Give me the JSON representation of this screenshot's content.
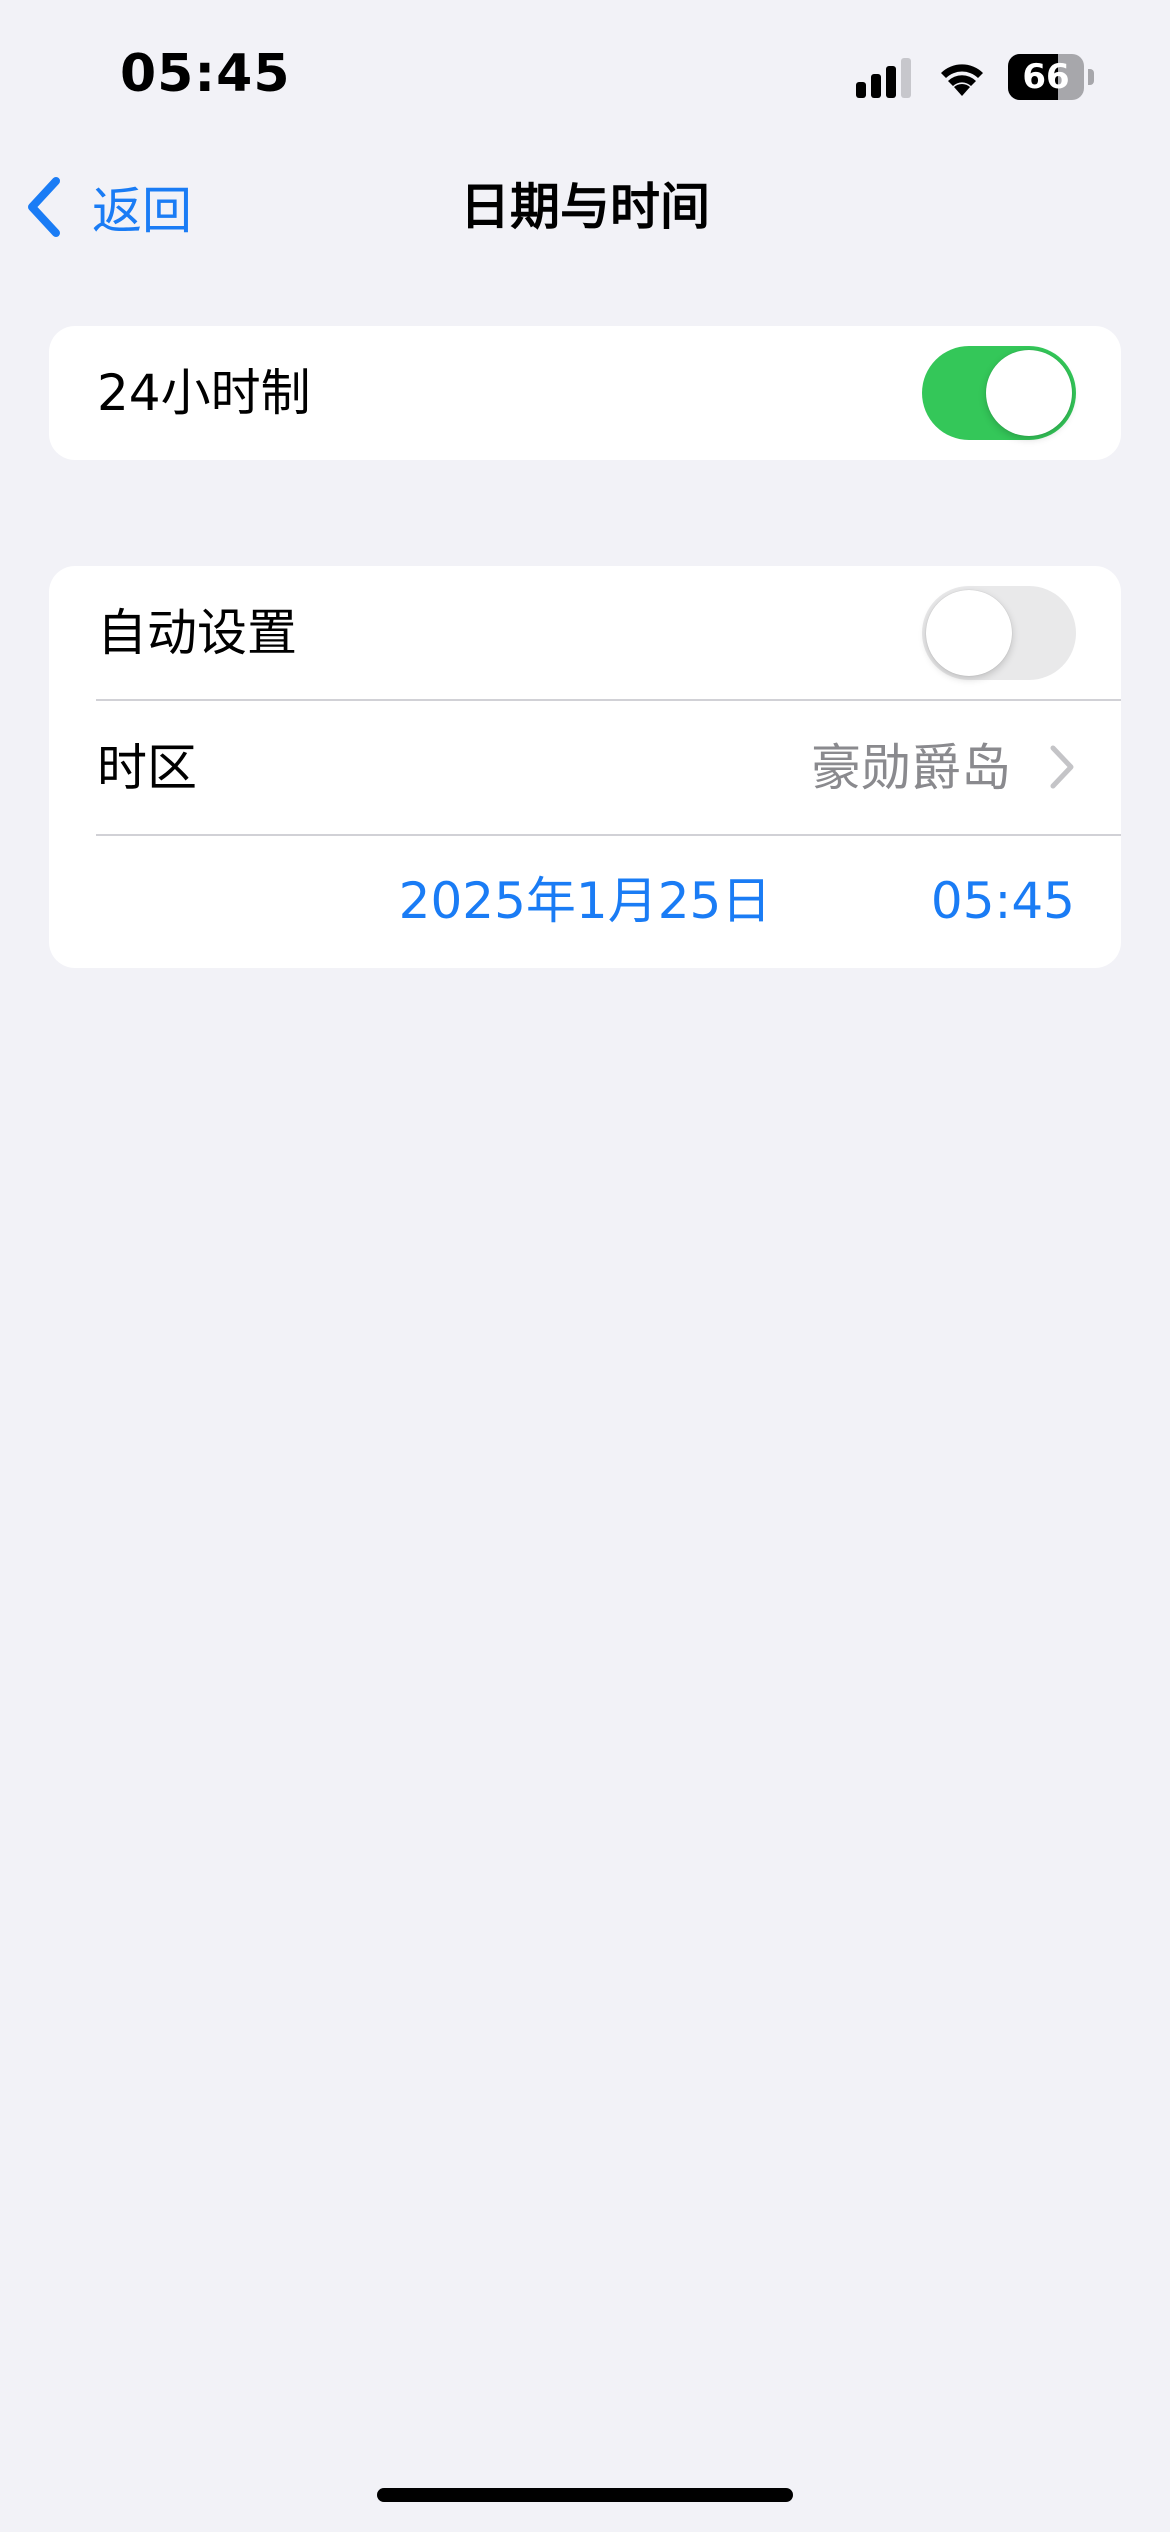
{
  "status_bar": {
    "time": "05:45",
    "battery_level": "66",
    "battery_fraction": 0.66,
    "signal_icon": "cellular-signal-icon",
    "wifi_icon": "wifi-icon",
    "battery_icon": "battery-icon"
  },
  "nav": {
    "back_label": "返回",
    "back_icon": "chevron-left-icon",
    "title": "日期与时间"
  },
  "settings": {
    "hour24": {
      "label": "24小时制",
      "enabled": true
    },
    "auto_set": {
      "label": "自动设置",
      "enabled": false
    },
    "timezone": {
      "label": "时区",
      "value": "豪勋爵岛",
      "chevron_icon": "chevron-right-icon"
    },
    "date": "2025年1月25日",
    "time": "05:45"
  },
  "colors": {
    "accent": "#1a7cf5",
    "toggle_on": "#34c759",
    "toggle_off": "#e9e9ea",
    "background": "#f2f2f7",
    "secondary_text": "#8a8a8e"
  }
}
